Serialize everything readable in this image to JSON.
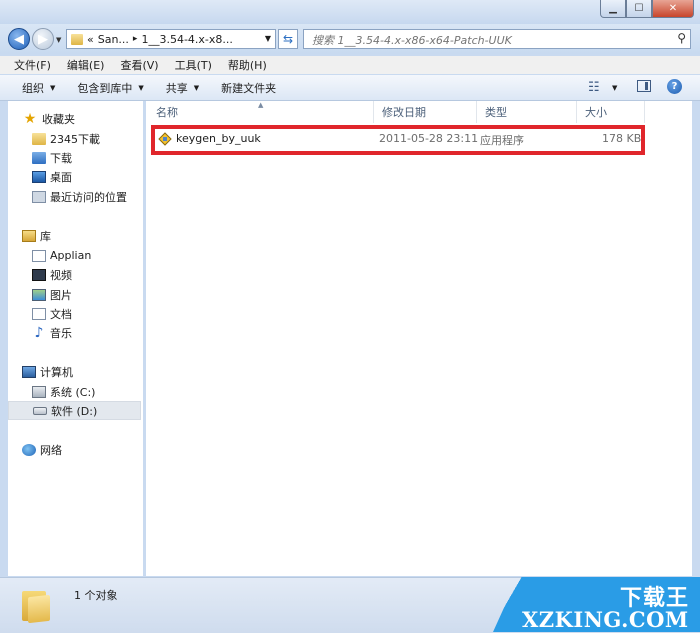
{
  "address": {
    "breadcrumb_prefix": "«",
    "crumb1": "San...",
    "sep": "▸",
    "crumb2": "1__3.54-4.x-x8..."
  },
  "search": {
    "placeholder": "搜索 1__3.54-4.x-x86-x64-Patch-UUK"
  },
  "menu": [
    "文件(F)",
    "编辑(E)",
    "查看(V)",
    "工具(T)",
    "帮助(H)"
  ],
  "toolbar": {
    "organize": "组织",
    "include_library": "包含到库中",
    "share": "共享",
    "new_folder": "新建文件夹"
  },
  "nav": {
    "favorites": "收藏夹",
    "fav_items": [
      "2345下載",
      "下载",
      "桌面",
      "最近访问的位置"
    ],
    "libraries": "库",
    "lib_items": [
      "Applian",
      "视频",
      "图片",
      "文档",
      "音乐"
    ],
    "computer": "计算机",
    "computer_items": [
      "系统 (C:)",
      "软件 (D:)"
    ],
    "network": "网络"
  },
  "columns": {
    "name": "名称",
    "date": "修改日期",
    "type": "类型",
    "size": "大小"
  },
  "files": [
    {
      "name": "keygen_by_uuk",
      "date": "2011-05-28 23:11",
      "type": "应用程序",
      "size": "178 KB"
    }
  ],
  "status": {
    "count": "1 个对象"
  },
  "watermark": {
    "line1": "下载王",
    "line2": "XZKING.COM"
  },
  "colors": {
    "highlight": "#e0262b",
    "accent": "#2a9ce6"
  }
}
